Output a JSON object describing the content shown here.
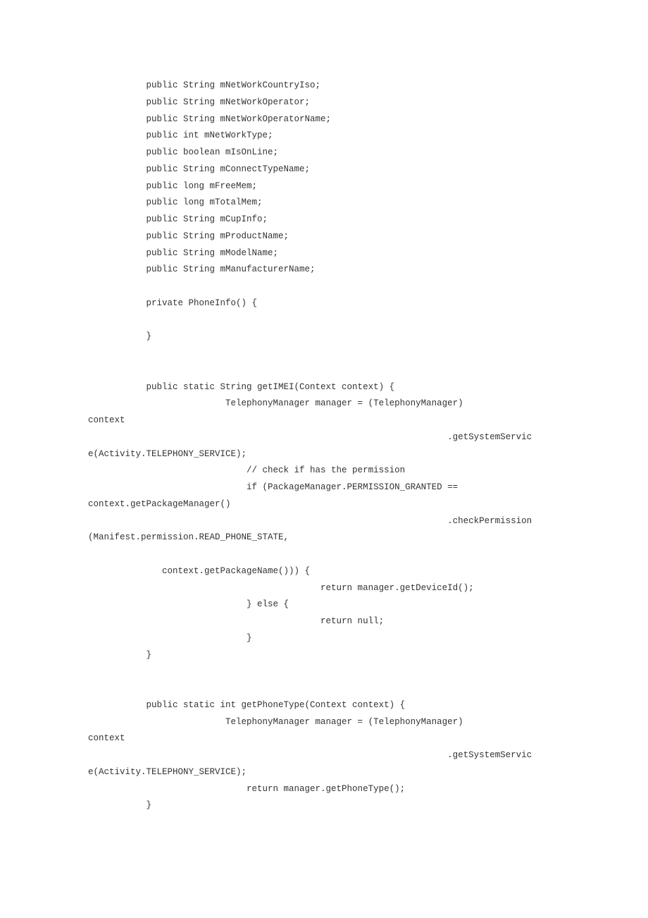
{
  "code": {
    "lines": [
      "           public String mNetWorkCountryIso;",
      "           public String mNetWorkOperator;",
      "           public String mNetWorkOperatorName;",
      "           public int mNetWorkType;",
      "           public boolean mIsOnLine;",
      "           public String mConnectTypeName;",
      "           public long mFreeMem;",
      "           public long mTotalMem;",
      "           public String mCupInfo;",
      "           public String mProductName;",
      "           public String mModelName;",
      "           public String mManufacturerName;",
      "",
      "           private PhoneInfo() {",
      "",
      "           }",
      "",
      "",
      "           public static String getIMEI(Context context) {",
      "                          TelephonyManager manager = (TelephonyManager) ",
      "context",
      "                                                                    .getSystemServic",
      "e(Activity.TELEPHONY_SERVICE);",
      "                              // check if has the permission",
      "                              if (PackageManager.PERMISSION_GRANTED == ",
      "context.getPackageManager()",
      "                                                                    .checkPermission",
      "(Manifest.permission.READ_PHONE_STATE,",
      "",
      "              context.getPackageName())) {",
      "                                            return manager.getDeviceId();",
      "                              } else {",
      "                                            return null;",
      "                              }",
      "           }",
      "",
      "",
      "           public static int getPhoneType(Context context) {",
      "                          TelephonyManager manager = (TelephonyManager) ",
      "context",
      "                                                                    .getSystemServic",
      "e(Activity.TELEPHONY_SERVICE);",
      "                              return manager.getPhoneType();",
      "           }"
    ]
  }
}
